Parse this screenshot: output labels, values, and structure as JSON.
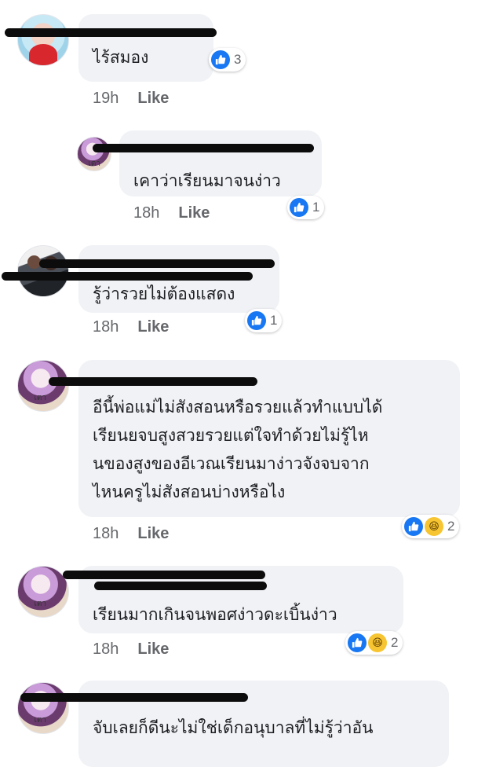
{
  "comments": [
    {
      "text": "ไร้สมอง",
      "time": "19h",
      "like": "Like",
      "reactions": [
        "like"
      ],
      "count": "3"
    },
    {
      "text": "เคาว่าเรียนมาจนง่าว",
      "time": "18h",
      "like": "Like",
      "reactions": [
        "like"
      ],
      "count": "1"
    },
    {
      "text": "รู้ว่ารวยไม่ต้องแสดง",
      "time": "18h",
      "like": "Like",
      "reactions": [
        "like"
      ],
      "count": "1"
    },
    {
      "text": "อีนี้พ่อแม่ไม่สังสอนหรือรวยแล้วทำแบบได้\nเรียนยจบสูงสวยรวยแต่ใจทำด้วยไม่รู้ไห\nนของสูงของอีเวณเรียนมาง่าวจังจบจาก\nไหนครูไม่สังสอนบ่างหรือไง",
      "time": "18h",
      "like": "Like",
      "reactions": [
        "like",
        "haha"
      ],
      "count": "2"
    },
    {
      "text": "เรียนมากเกินจนพอศง่าวดะเบิ้นง่าว",
      "time": "18h",
      "like": "Like",
      "reactions": [
        "like",
        "haha"
      ],
      "count": "2"
    },
    {
      "text": "จับเลยก็ดีนะไม่ใช่เด็กอนุบาลที่ไม่รู้ว่าอัน",
      "time": "",
      "like": "",
      "reactions": [],
      "count": ""
    }
  ],
  "icons": {
    "like": "thumbs-up-icon",
    "haha": "laughing-face-icon",
    "avatar": "profile-avatar"
  },
  "colors": {
    "bubble": "#f0f2f5",
    "like_blue": "#1877f2",
    "haha_yellow": "#f7c531",
    "meta_gray": "#65676b"
  }
}
